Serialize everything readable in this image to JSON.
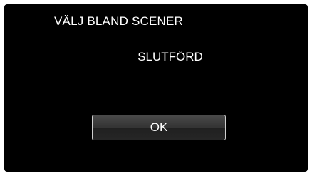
{
  "dialog": {
    "title": "VÄLJ BLAND SCENER",
    "message": "SLUTFÖRD",
    "ok_label": "OK"
  },
  "colors": {
    "background": "#000000",
    "text": "#ffffff",
    "button_border": "#cfcfcf"
  }
}
